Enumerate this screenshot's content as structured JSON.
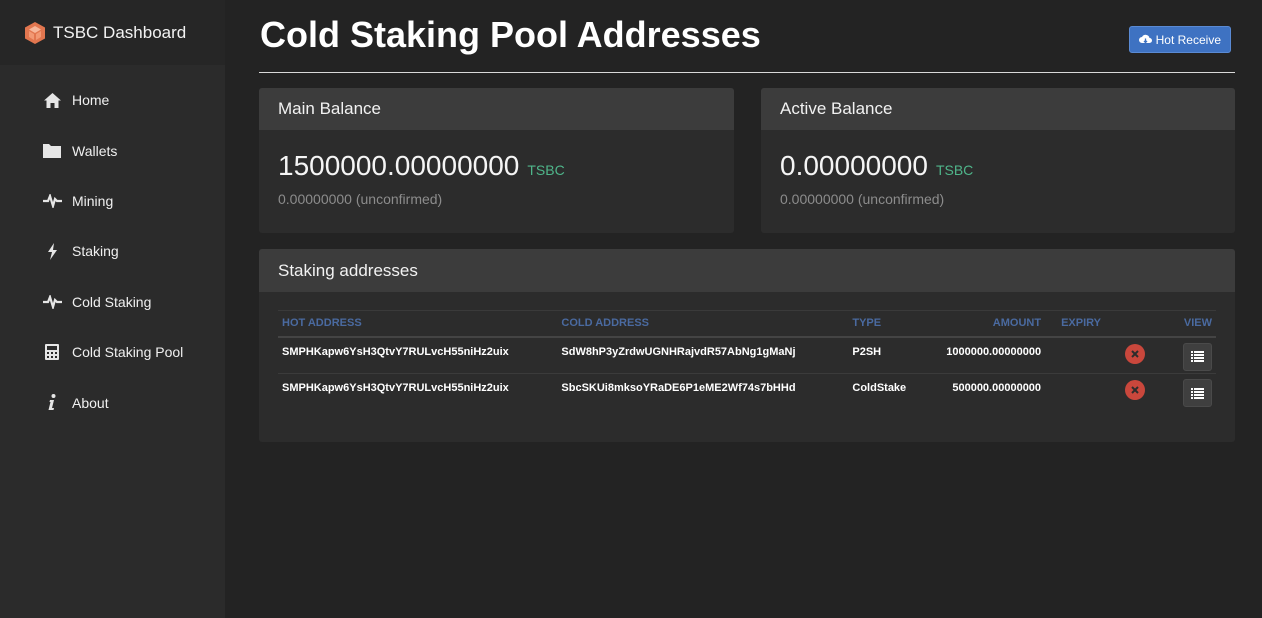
{
  "app": {
    "title": "TSBC Dashboard"
  },
  "sidebar": {
    "items": [
      {
        "label": "Home",
        "icon": "home-icon"
      },
      {
        "label": "Wallets",
        "icon": "folder-icon"
      },
      {
        "label": "Mining",
        "icon": "pulse-icon"
      },
      {
        "label": "Staking",
        "icon": "bolt-icon"
      },
      {
        "label": "Cold Staking",
        "icon": "pulse-icon"
      },
      {
        "label": "Cold Staking Pool",
        "icon": "calculator-icon"
      },
      {
        "label": "About",
        "icon": "info-icon"
      }
    ]
  },
  "page": {
    "title": "Cold Staking Pool Addresses",
    "hot_receive_label": "Hot Receive"
  },
  "main_balance": {
    "title": "Main Balance",
    "value": "1500000.00000000",
    "unit": "TSBC",
    "unconfirmed": "0.00000000 (unconfirmed)"
  },
  "active_balance": {
    "title": "Active Balance",
    "value": "0.00000000",
    "unit": "TSBC",
    "unconfirmed": "0.00000000 (unconfirmed)"
  },
  "staking": {
    "title": "Staking addresses",
    "columns": [
      "HOT ADDRESS",
      "COLD ADDRESS",
      "TYPE",
      "AMOUNT",
      "EXPIRY",
      "VIEW"
    ],
    "rows": [
      {
        "hot": "SMPHKapw6YsH3QtvY7RULvcH55niHz2uix",
        "cold": "SdW8hP3yZrdwUGNHRajvdR57AbNg1gMaNj",
        "type": "P2SH",
        "amount": "1000000.00000000",
        "expiry": ""
      },
      {
        "hot": "SMPHKapw6YsH3QtvY7RULvcH55niHz2uix",
        "cold": "SbcSKUi8mksoYRaDE6P1eME2Wf74s7bHHd",
        "type": "ColdStake",
        "amount": "500000.00000000",
        "expiry": ""
      }
    ]
  },
  "colors": {
    "accent": "#3e72c2",
    "unit": "#4fb58a",
    "delete": "#c9473c",
    "header_text": "#4a6aa0"
  }
}
